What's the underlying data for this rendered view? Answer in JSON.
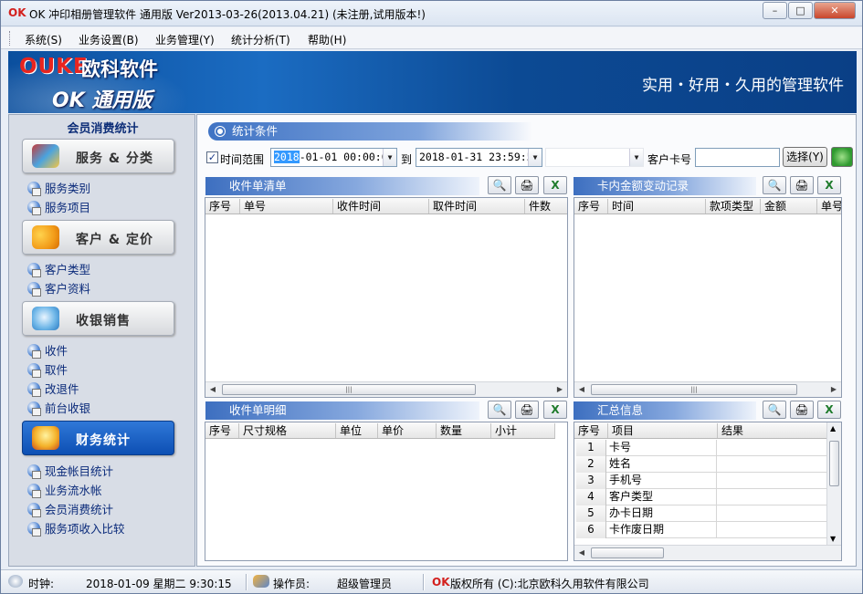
{
  "window": {
    "logo": "OK",
    "title": "OK 冲印相册管理软件 通用版 Ver2013-03-26(2013.04.21) (未注册,试用版本!)",
    "controls": {
      "minimize": "–",
      "maximize": "□",
      "close": "✕"
    }
  },
  "menu": [
    "系统(S)",
    "业务设置(B)",
    "业务管理(Y)",
    "统计分析(T)",
    "帮助(H)"
  ],
  "banner": {
    "brand_latin": "OUKE",
    "brand_cn": "欧科软件",
    "edition": "OK 通用版",
    "slogan": "实用・好用・久用的管理软件"
  },
  "sidebar": {
    "title": "会员消费统计",
    "groups": [
      {
        "label": "服务 & 分类",
        "items": [
          "服务类别",
          "服务项目"
        ],
        "active": false
      },
      {
        "label": "客户 & 定价",
        "items": [
          "客户类型",
          "客户资料"
        ],
        "active": false
      },
      {
        "label": "收银销售",
        "items": [
          "收件",
          "取件",
          "改退件",
          "前台收银"
        ],
        "active": false
      },
      {
        "label": "财务统计",
        "items": [
          "现金帐目统计",
          "业务流水帐",
          "会员消费统计",
          "服务项收入比较"
        ],
        "active": true
      }
    ]
  },
  "conditions": {
    "header": "统计条件",
    "time_range_label": "时间范围",
    "time_range_checked": true,
    "checkmark": "✓",
    "start_prefix": "2018",
    "start_rest": "-01-01 00:00:00",
    "to_label": "到",
    "end": "2018-01-31 23:59:59",
    "customer_card_label": "客户卡号",
    "customer_card_value": "",
    "select_button": "选择(Y)"
  },
  "panels": {
    "receipts": {
      "title": "收件单清单",
      "columns": [
        "序号",
        "单号",
        "收件时间",
        "取件时间",
        "件数"
      ]
    },
    "card_changes": {
      "title": "卡内金额变动记录",
      "columns": [
        "序号",
        "时间",
        "款项类型",
        "金额",
        "单号"
      ]
    },
    "receipt_detail": {
      "title": "收件单明细",
      "columns": [
        "序号",
        "尺寸规格",
        "单位",
        "单价",
        "数量",
        "小计"
      ]
    },
    "summary": {
      "title": "汇总信息",
      "columns": [
        "序号",
        "项目",
        "结果"
      ],
      "rows": [
        {
          "no": "1",
          "item": "卡号",
          "result": ""
        },
        {
          "no": "2",
          "item": "姓名",
          "result": ""
        },
        {
          "no": "3",
          "item": "手机号",
          "result": ""
        },
        {
          "no": "4",
          "item": "客户类型",
          "result": ""
        },
        {
          "no": "5",
          "item": "办卡日期",
          "result": ""
        },
        {
          "no": "6",
          "item": "卡作废日期",
          "result": ""
        }
      ]
    },
    "toolbar_icons": [
      "preview-icon",
      "print-icon",
      "excel-icon"
    ]
  },
  "statusbar": {
    "clock_label": "时钟:",
    "clock_value": "2018-01-09 星期二 9:30:15",
    "operator_label": "操作员:",
    "operator_value": "超级管理员",
    "logo": "OK",
    "copyright": "版权所有 (C):北京欧科久用软件有限公司"
  },
  "colors": {
    "accent": "#3d6fc0",
    "brand_red": "#d3201e",
    "banner": "#0b4f9e",
    "active_button": "#1d63c6"
  }
}
